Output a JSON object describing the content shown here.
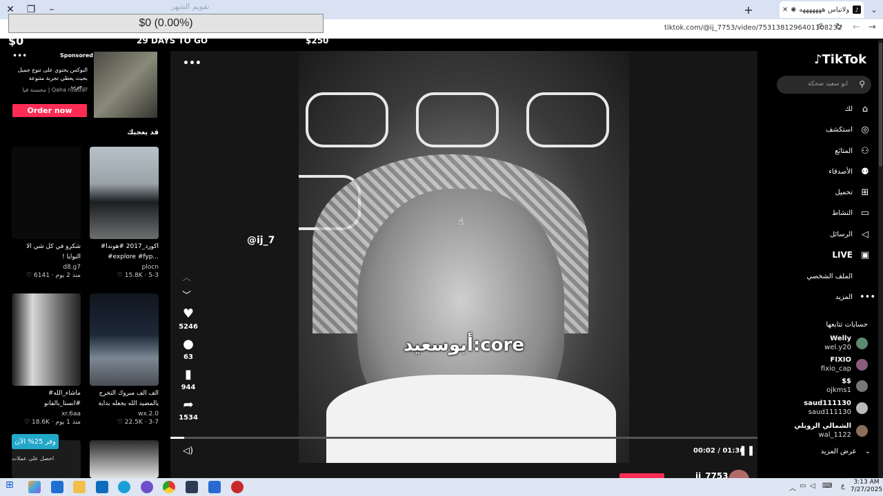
{
  "browser": {
    "tab_title": "لاتحزن ولاتيأس هههههههه",
    "faint_title": "تقويم الشهر",
    "url": "tiktok.com/@ij_7753/video/7531381296401108232"
  },
  "overlay": {
    "tick_box": "$0 (0.00%)",
    "left_value": "$0",
    "middle_text": "29 DAYS TO GO",
    "right_value": "$250"
  },
  "ad": {
    "sponsored": "Sponsored",
    "text": "البوكس يحتوي على تنوع جميل بحيث يعطي تجربة متنوعة جرب...",
    "advertiser": "محسنة فيا | Qaha roaster",
    "cta": "Order now"
  },
  "you_may_like": "قد يعجبك",
  "cards": [
    {
      "caption": "شكرو في كل شي الا النوايا ! #الشعب_الصيني_ماله_حل...",
      "author": "d8.g7",
      "meta": "6141 · منذ 2 يوم"
    },
    {
      "caption": "#اكورد_2017 #هوندا #explore #fyp...",
      "author": "plocn",
      "meta": "15.8K · 5-3"
    },
    {
      "caption": "#ماشاء_الله #انستا_بالفانو",
      "author": "xr.6aa",
      "meta": "18.6K · منذ 1 يوم"
    },
    {
      "caption": "الف الف مبروك التخرج يالمضيد الله يجعله بداية الخير...",
      "author": "wx.2.0",
      "meta": "22.5K · 3-7"
    }
  ],
  "promo": {
    "label": "وفر 25% الآن",
    "sub": "احصل على عملات"
  },
  "video": {
    "handle_overlay": "@ij_7",
    "caption_overlay": "أبوسعيد:core",
    "likes": "5246",
    "comments": "63",
    "saves": "944",
    "shares": "1534",
    "time": "00:02 / 01:30",
    "progress": 0.023,
    "next_author": "ij_7753"
  },
  "sidebar": {
    "logo": "TikTok",
    "search_placeholder": "ابو سعيد ضحكة",
    "nav": [
      {
        "label": "لك",
        "icon": "home-icon",
        "glyph": "⌂"
      },
      {
        "label": "استكشف",
        "icon": "compass-icon",
        "glyph": "◎"
      },
      {
        "label": "المتابَع",
        "icon": "following-icon",
        "glyph": "⚇"
      },
      {
        "label": "الأصدقاء",
        "icon": "friends-icon",
        "glyph": "⚉"
      },
      {
        "label": "تحميل",
        "icon": "upload-icon",
        "glyph": "⊞"
      },
      {
        "label": "النشاط",
        "icon": "activity-icon",
        "glyph": "▭"
      },
      {
        "label": "الرسائل",
        "icon": "messages-icon",
        "glyph": "◁"
      },
      {
        "label": "LIVE",
        "icon": "live-icon",
        "glyph": "▣"
      },
      {
        "label": "الملف الشخصي",
        "icon": "profile-icon",
        "glyph": ""
      },
      {
        "label": "المزيد",
        "icon": "more-icon",
        "glyph": "•••"
      }
    ],
    "following_title": "حسابات تتابعها",
    "accounts": [
      {
        "name": "Welly",
        "handle": "wel.y20",
        "color": "#5b8a6e"
      },
      {
        "name": "FIXIO",
        "handle": "fixio_cap",
        "color": "#8a5b7a"
      },
      {
        "name": "$$",
        "handle": "ojkms1",
        "color": "#777777"
      },
      {
        "name": "saud111130",
        "handle": "saud111130",
        "color": "#bbbbbb"
      },
      {
        "name": "الشمالي الرويلي",
        "handle": "wal_1122",
        "color": "#8a6e5b"
      }
    ],
    "see_more": "عرض المزيد"
  },
  "taskbar": {
    "time": "3:13 AM",
    "date": "7/27/2025",
    "lang": "ع"
  }
}
